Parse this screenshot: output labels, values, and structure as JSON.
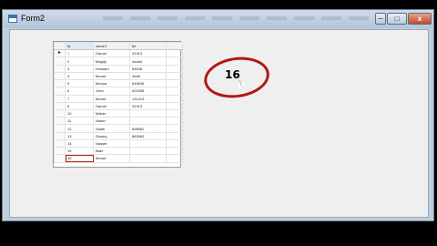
{
  "window": {
    "title": "Form2",
    "controls": {
      "minimize": "─",
      "maximize": "□",
      "close": "x"
    }
  },
  "grid": {
    "columns": [
      "id",
      "name1",
      "tel"
    ],
    "rows": [
      {
        "id": "1",
        "name": "Gamal",
        "tel": "31313"
      },
      {
        "id": "2",
        "name": "Magdy",
        "tel": "4a4a4"
      },
      {
        "id": "3",
        "name": "Hossam",
        "tel": "64646"
      },
      {
        "id": "4",
        "name": "Morad",
        "tel": "4646"
      },
      {
        "id": "5",
        "name": "Mouna",
        "tel": "649646"
      },
      {
        "id": "6",
        "name": "John",
        "tel": "629298"
      },
      {
        "id": "7",
        "name": "Morad",
        "tel": "131313"
      },
      {
        "id": "8",
        "name": "Gamal",
        "tel": "31313"
      },
      {
        "id": "10",
        "name": "Maher",
        "tel": ""
      },
      {
        "id": "11",
        "name": "Nader",
        "tel": ""
      },
      {
        "id": "12",
        "name": "Salah",
        "tel": "898962"
      },
      {
        "id": "13",
        "name": "Shokry",
        "tel": "883963"
      },
      {
        "id": "14",
        "name": "Nasser",
        "tel": ""
      },
      {
        "id": "15",
        "name": "Bakr",
        "tel": ""
      },
      {
        "id": "16",
        "name": "Morad",
        "tel": ""
      }
    ],
    "current_row_marker": "▸",
    "active_cell": {
      "row": 14,
      "col": "id"
    }
  },
  "annotation": {
    "text": "16"
  },
  "colors": {
    "annotation_circle": "#b01818",
    "active_cell_border": "#b22222"
  }
}
